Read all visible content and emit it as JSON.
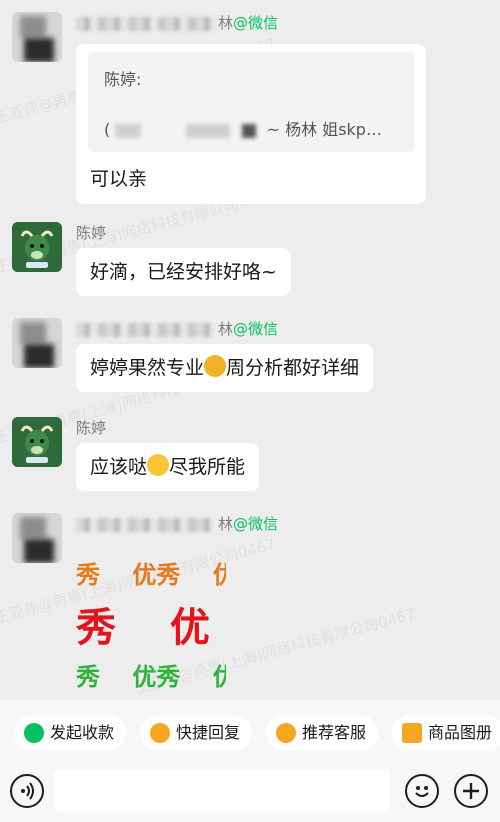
{
  "watermark": {
    "lines": [
      "王亚伟@再惠(上海)网络科技有限公司0467",
      "王亚伟@再惠(上海)网络科技有限公司0467",
      "王亚伟@再惠(上海)网络科技有限公司0467",
      "王亚伟@再惠(上海)网络科技有限公司0467",
      "王亚伟@再惠(上海)网络科技有限公司0467"
    ]
  },
  "messages": [
    {
      "sender_suffix": "林",
      "sender_tag": "@微信",
      "quote_name": "陈婷:",
      "quote_text_prefix": "(",
      "quote_text_visible": "~ 杨林 姐skp…",
      "reply": "可以亲"
    },
    {
      "sender": "陈婷",
      "text": "好滴，已经安排好咯~"
    },
    {
      "sender_suffix": "林",
      "sender_tag": "@微信",
      "text_before_emoji": "婷婷果然专业",
      "text_after_emoji": "周分析都好详细"
    },
    {
      "sender": "陈婷",
      "text_before_emoji": "应该哒",
      "text_after_emoji": "尽我所能"
    },
    {
      "sender_suffix": "林",
      "sender_tag": "@微信",
      "sticker_rows": [
        {
          "text": "秀　 优秀　 优",
          "color": "#e57a19"
        },
        {
          "text": "秀　 优",
          "color": "#e4141b"
        },
        {
          "text": "秀　 优秀　 优",
          "color": "#2fb33b"
        }
      ]
    }
  ],
  "quick_replies": [
    {
      "label": "发起收款",
      "icon": "yuan-shield-icon",
      "color": "#07c160"
    },
    {
      "label": "快捷回复",
      "icon": "quick-reply-icon",
      "color": "#f5a623"
    },
    {
      "label": "推荐客服",
      "icon": "recommend-agent-icon",
      "color": "#f5a623"
    },
    {
      "label": "商品图册",
      "icon": "product-album-icon",
      "color": "#f5a623"
    }
  ],
  "input": {
    "placeholder": ""
  },
  "colors": {
    "wechat_green": "#07c160",
    "background": "#ededed",
    "bubble": "#ffffff"
  }
}
